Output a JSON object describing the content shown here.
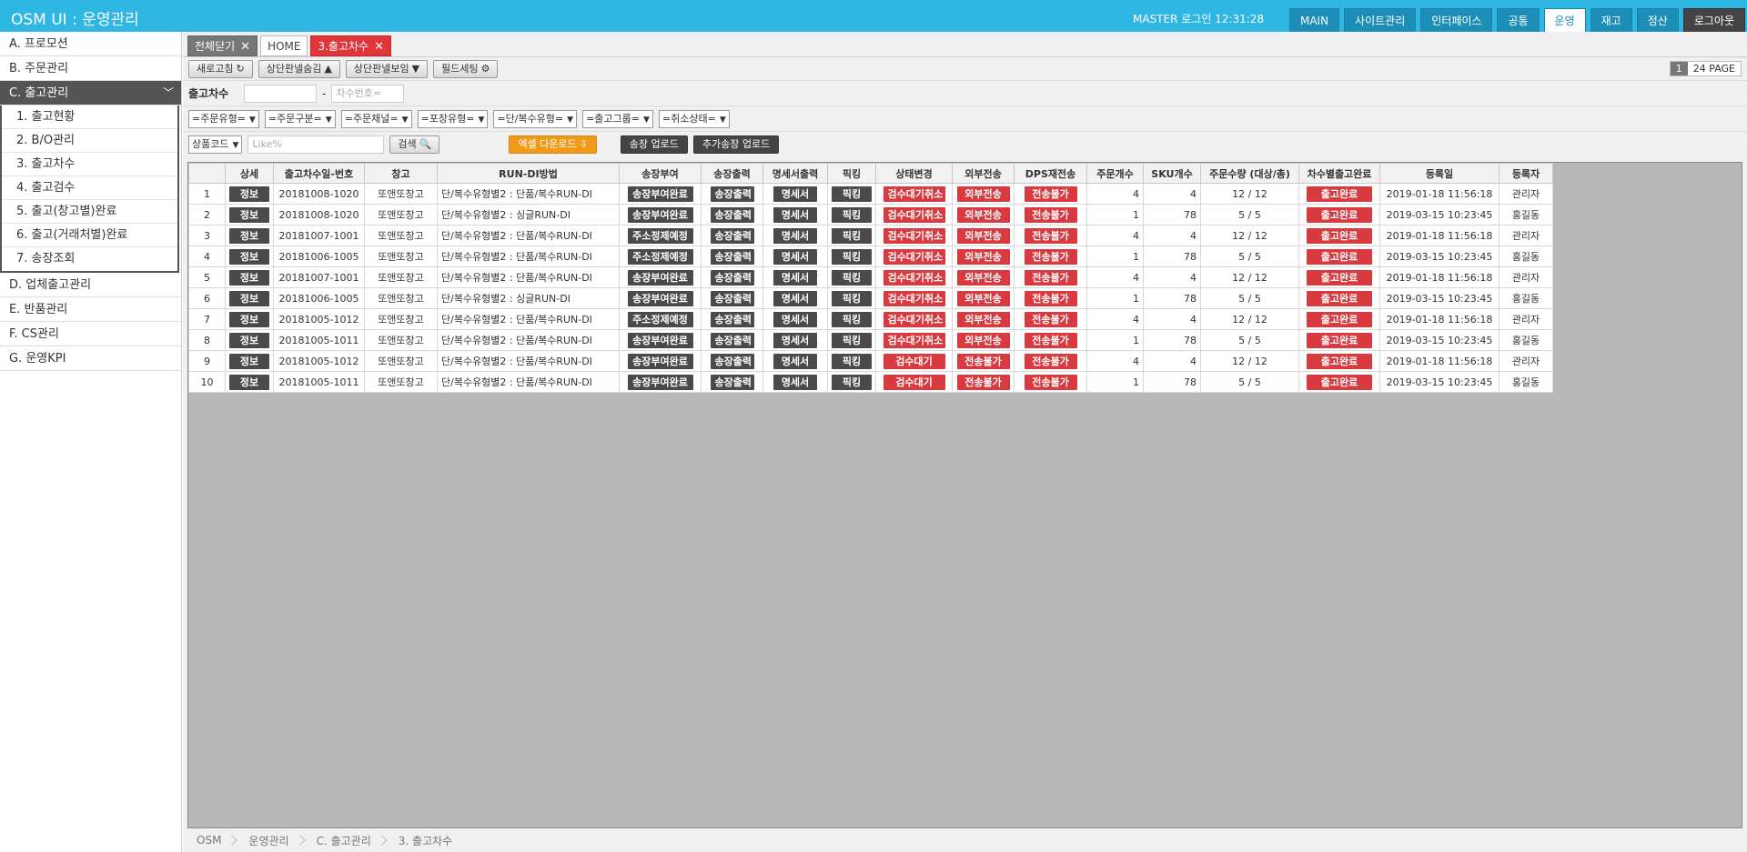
{
  "header": {
    "title": "OSM UI : 운영관리",
    "user_info": "MASTER 로그인 12:31:28",
    "nav": [
      {
        "label": "MAIN",
        "name": "nav-main",
        "style": "normal"
      },
      {
        "label": "사이트관리",
        "name": "nav-site-admin",
        "style": "normal"
      },
      {
        "label": "인터페이스",
        "name": "nav-interface",
        "style": "normal"
      },
      {
        "label": "공통",
        "name": "nav-common",
        "style": "normal"
      },
      {
        "label": "운영",
        "name": "nav-operation",
        "style": "active"
      },
      {
        "label": "재고",
        "name": "nav-inventory",
        "style": "normal"
      },
      {
        "label": "정산",
        "name": "nav-settlement",
        "style": "normal"
      },
      {
        "label": "로그아웃",
        "name": "nav-logout",
        "style": "logout"
      }
    ]
  },
  "sidebar": {
    "menus": [
      {
        "label": "A. 프로모션"
      },
      {
        "label": "B. 주문관리"
      },
      {
        "label": "C. 출고관리",
        "active": true,
        "children": [
          "1. 출고현황",
          "2. B/O관리",
          "3. 출고차수",
          "4. 출고검수",
          "5. 출고(창고별)완료",
          "6. 출고(거래처별)완료",
          "7. 송장조회"
        ]
      },
      {
        "label": "D. 업체출고관리"
      },
      {
        "label": "E. 반품관리"
      },
      {
        "label": "F. CS관리"
      },
      {
        "label": "G. 운영KPI"
      }
    ]
  },
  "tabs": {
    "close_all": "전체닫기",
    "home": "HOME",
    "current": "3.출고차수",
    "close_glyph": "✕"
  },
  "toolbar": {
    "refresh": "새로고침",
    "refresh_icon": "↻",
    "hide_panel": "상단판넬숨김",
    "hide_icon": "▲",
    "show_panel": "상단판넬보임",
    "show_icon": "▼",
    "field_setting": "필드세팅",
    "gear_icon": "⚙",
    "pager_current": "1",
    "pager_total": "24 PAGE"
  },
  "filters": {
    "batch_label": "출고차수",
    "batch_from_value": "",
    "batch_sep": "-",
    "batch_to_placeholder": "차수번호=",
    "selects": [
      "=주문유형=",
      "=주문구분=",
      "=주문채널=",
      "=포장유형=",
      "=단/복수유형=",
      "=출고그룹=",
      "=취소상태="
    ],
    "search_field": "상품코드",
    "search_placeholder": "Like%",
    "search_button": "검색",
    "search_icon": "🔍",
    "excel_download": "엑셀 다운로드",
    "excel_icon": "⇩",
    "invoice_upload": "송장 업로드",
    "extra_invoice_upload": "추가송장 업로드"
  },
  "table": {
    "columns": [
      "",
      "상세",
      "출고차수일-번호",
      "창고",
      "RUN-DI방법",
      "송장부여",
      "송장출력",
      "명세서출력",
      "픽킹",
      "상태변경",
      "외부전송",
      "DPS재전송",
      "주문개수",
      "SKU개수",
      "주문수량 (대상/총)",
      "차수별출고완료",
      "등록일",
      "등록자"
    ],
    "rows": [
      {
        "no": "1",
        "detail": "정보",
        "batch": "20181008-1020",
        "wh": "또앤또창고",
        "method": "단/복수유형별2 : 단품/복수RUN-DI",
        "invoice": "송장부여완료",
        "print": "송장출력",
        "stmt": "명세서",
        "pick": "픽킹",
        "status": "검수대기취소",
        "ext": "외부전송",
        "dps": "전송불가",
        "orders": "4",
        "sku": "4",
        "qty": "12 / 12",
        "done": "출고완료",
        "date": "2019-01-18 11:56:18",
        "user": "관리자"
      },
      {
        "no": "2",
        "detail": "정보",
        "batch": "20181008-1020",
        "wh": "또앤또창고",
        "method": "단/복수유형별2 : 싱글RUN-DI",
        "invoice": "송장부여완료",
        "print": "송장출력",
        "stmt": "명세서",
        "pick": "픽킹",
        "status": "검수대기취소",
        "ext": "외부전송",
        "dps": "전송불가",
        "orders": "1",
        "sku": "78",
        "qty": "5 / 5",
        "done": "출고완료",
        "date": "2019-03-15 10:23:45",
        "user": "홍길동"
      },
      {
        "no": "3",
        "detail": "정보",
        "batch": "20181007-1001",
        "wh": "또앤또창고",
        "method": "단/복수유형별2 : 단품/복수RUN-DI",
        "invoice": "주소정제예정",
        "print": "송장출력",
        "stmt": "명세서",
        "pick": "픽킹",
        "status": "검수대기취소",
        "ext": "외부전송",
        "dps": "전송불가",
        "orders": "4",
        "sku": "4",
        "qty": "12 / 12",
        "done": "출고완료",
        "date": "2019-01-18 11:56:18",
        "user": "관리자"
      },
      {
        "no": "4",
        "detail": "정보",
        "batch": "20181006-1005",
        "wh": "또앤또창고",
        "method": "단/복수유형별2 : 단품/복수RUN-DI",
        "invoice": "주소정제예정",
        "print": "송장출력",
        "stmt": "명세서",
        "pick": "픽킹",
        "status": "검수대기취소",
        "ext": "외부전송",
        "dps": "전송불가",
        "orders": "1",
        "sku": "78",
        "qty": "5 / 5",
        "done": "출고완료",
        "date": "2019-03-15 10:23:45",
        "user": "홍길동"
      },
      {
        "no": "5",
        "detail": "정보",
        "batch": "20181007-1001",
        "wh": "또앤또창고",
        "method": "단/복수유형별2 : 단품/복수RUN-DI",
        "invoice": "송장부여완료",
        "print": "송장출력",
        "stmt": "명세서",
        "pick": "픽킹",
        "status": "검수대기취소",
        "ext": "외부전송",
        "dps": "전송불가",
        "orders": "4",
        "sku": "4",
        "qty": "12 / 12",
        "done": "출고완료",
        "date": "2019-01-18 11:56:18",
        "user": "관리자"
      },
      {
        "no": "6",
        "detail": "정보",
        "batch": "20181006-1005",
        "wh": "또앤또창고",
        "method": "단/복수유형별2 : 싱글RUN-DI",
        "invoice": "송장부여완료",
        "print": "송장출력",
        "stmt": "명세서",
        "pick": "픽킹",
        "status": "검수대기취소",
        "ext": "외부전송",
        "dps": "전송불가",
        "orders": "1",
        "sku": "78",
        "qty": "5 / 5",
        "done": "출고완료",
        "date": "2019-03-15 10:23:45",
        "user": "홍길동"
      },
      {
        "no": "7",
        "detail": "정보",
        "batch": "20181005-1012",
        "wh": "또앤또창고",
        "method": "단/복수유형별2 : 단품/복수RUN-DI",
        "invoice": "주소정제예정",
        "print": "송장출력",
        "stmt": "명세서",
        "pick": "픽킹",
        "status": "검수대기취소",
        "ext": "외부전송",
        "dps": "전송불가",
        "orders": "4",
        "sku": "4",
        "qty": "12 / 12",
        "done": "출고완료",
        "date": "2019-01-18 11:56:18",
        "user": "관리자"
      },
      {
        "no": "8",
        "detail": "정보",
        "batch": "20181005-1011",
        "wh": "또앤또창고",
        "method": "단/복수유형별2 : 단품/복수RUN-DI",
        "invoice": "송장부여완료",
        "print": "송장출력",
        "stmt": "명세서",
        "pick": "픽킹",
        "status": "검수대기취소",
        "ext": "외부전송",
        "dps": "전송불가",
        "orders": "1",
        "sku": "78",
        "qty": "5 / 5",
        "done": "출고완료",
        "date": "2019-03-15 10:23:45",
        "user": "홍길동"
      },
      {
        "no": "9",
        "detail": "정보",
        "batch": "20181005-1012",
        "wh": "또앤또창고",
        "method": "단/복수유형별2 : 단품/복수RUN-DI",
        "invoice": "송장부여완료",
        "print": "송장출력",
        "stmt": "명세서",
        "pick": "픽킹",
        "status": "검수대기",
        "ext": "전송불가",
        "dps": "전송불가",
        "orders": "4",
        "sku": "4",
        "qty": "12 / 12",
        "done": "출고완료",
        "date": "2019-01-18 11:56:18",
        "user": "관리자"
      },
      {
        "no": "10",
        "detail": "정보",
        "batch": "20181005-1011",
        "wh": "또앤또창고",
        "method": "단/복수유형별2 : 단품/복수RUN-DI",
        "invoice": "송장부여완료",
        "print": "송장출력",
        "stmt": "명세서",
        "pick": "픽킹",
        "status": "검수대기",
        "ext": "전송불가",
        "dps": "전송불가",
        "orders": "1",
        "sku": "78",
        "qty": "5 / 5",
        "done": "출고완료",
        "date": "2019-03-15 10:23:45",
        "user": "홍길동"
      }
    ]
  },
  "breadcrumb": [
    "OSM",
    "운영관리",
    "C. 출고관리",
    "3. 출고차수"
  ]
}
